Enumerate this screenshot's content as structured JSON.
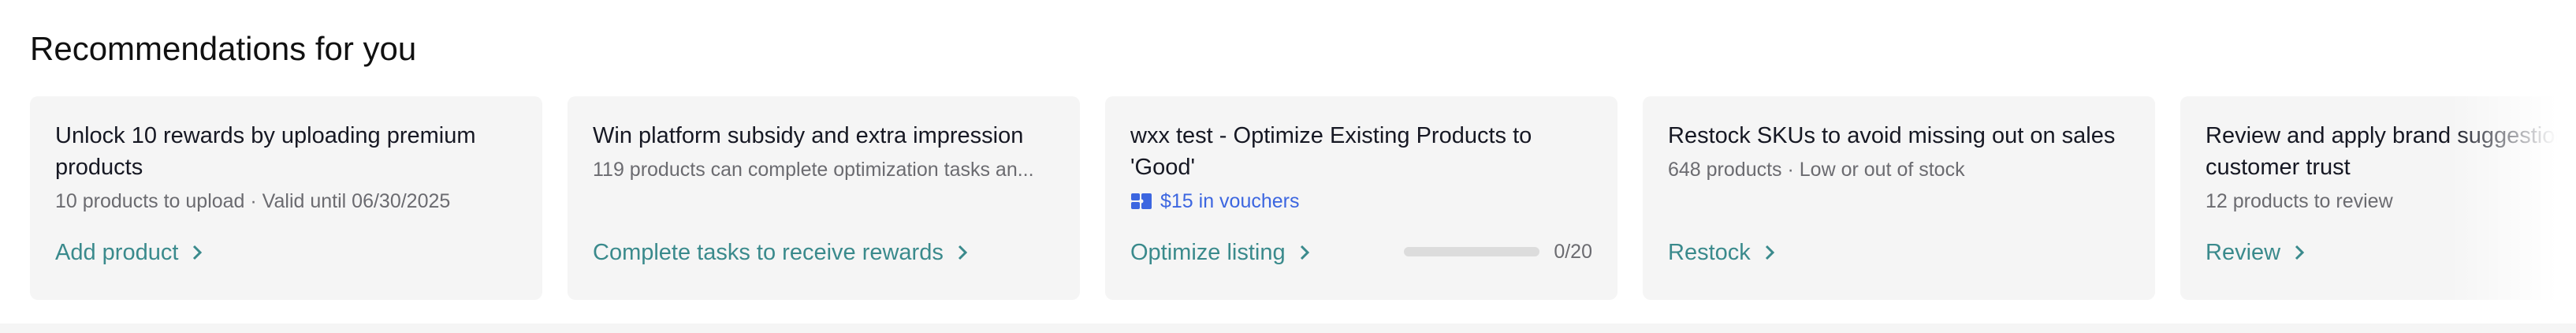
{
  "section": {
    "title": "Recommendations for you"
  },
  "cards": [
    {
      "title": "Unlock 10 rewards by uploading premium products",
      "subtitle": "10 products to upload · Valid until 06/30/2025",
      "action": "Add product"
    },
    {
      "title": "Win platform subsidy and extra impression",
      "subtitle": "119 products can complete optimization tasks an...",
      "action": "Complete tasks to receive rewards"
    },
    {
      "title": "wxx test - Optimize Existing Products to 'Good'",
      "voucher": "$15 in vouchers",
      "action": "Optimize listing",
      "progress": {
        "label": "0/20",
        "fraction": 0
      }
    },
    {
      "title": "Restock SKUs to avoid missing out on sales",
      "subtitle": "648 products · Low or out of stock",
      "action": "Restock"
    },
    {
      "title": "Review and apply brand suggestions to build customer trust",
      "subtitle": "12 products to review",
      "action": "Review"
    }
  ],
  "colors": {
    "accent": "#3a8a8c",
    "voucher": "#3c66e0",
    "card_bg": "#f5f5f5"
  },
  "icons": {
    "voucher": "voucher-icon",
    "action": "chevron-right-icon"
  }
}
